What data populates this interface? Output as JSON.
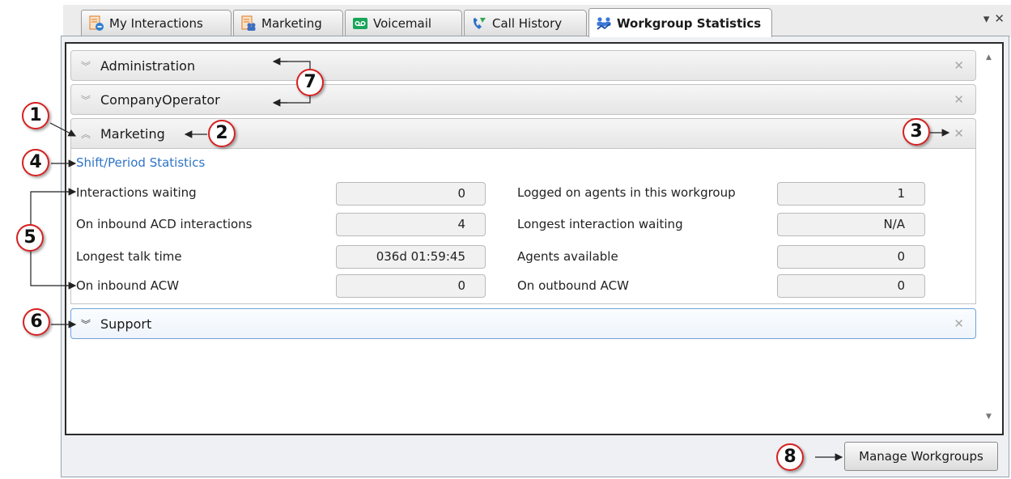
{
  "tabs": [
    {
      "label": "My Interactions",
      "icon": "interactions-icon"
    },
    {
      "label": "Marketing",
      "icon": "workgroup-queue-icon"
    },
    {
      "label": "Voicemail",
      "icon": "voicemail-icon"
    },
    {
      "label": "Call History",
      "icon": "call-history-icon"
    },
    {
      "label": "Workgroup Statistics",
      "icon": "workgroup-statistics-icon",
      "active": true
    }
  ],
  "tab_tools": {
    "menu": "▾",
    "close": "✕"
  },
  "groups": [
    {
      "name": "Administration",
      "expanded": false
    },
    {
      "name": "CompanyOperator",
      "expanded": false
    },
    {
      "name": "Marketing",
      "expanded": true
    },
    {
      "name": "Support",
      "expanded": false
    }
  ],
  "section_title": "Shift/Period Statistics",
  "stats": {
    "left": [
      {
        "label": "Interactions waiting",
        "value": "0"
      },
      {
        "label": "On inbound ACD interactions",
        "value": "4"
      },
      {
        "label": "Longest talk time",
        "value": "036d 01:59:45"
      },
      {
        "label": "On inbound ACW",
        "value": "0"
      }
    ],
    "right": [
      {
        "label": "Logged on agents in this workgroup",
        "value": "1"
      },
      {
        "label": "Longest interaction waiting",
        "value": "N/A"
      },
      {
        "label": "Agents available",
        "value": "0"
      },
      {
        "label": "On outbound ACW",
        "value": "0"
      }
    ]
  },
  "manage_button": "Manage Workgroups",
  "callouts": [
    "1",
    "2",
    "3",
    "4",
    "5",
    "6",
    "7",
    "8"
  ],
  "colors": {
    "link": "#2f74c6",
    "callout_border": "#d62020",
    "selected_border": "#6ea2d8"
  }
}
